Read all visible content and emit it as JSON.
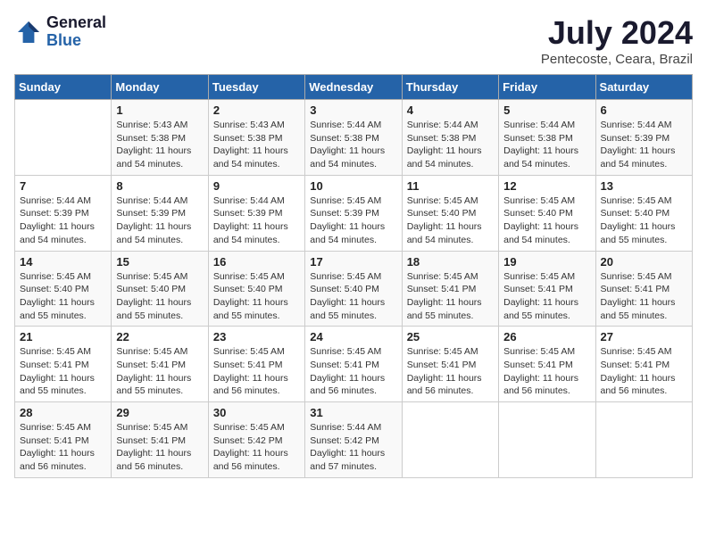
{
  "logo": {
    "text_general": "General",
    "text_blue": "Blue"
  },
  "title": "July 2024",
  "subtitle": "Pentecoste, Ceara, Brazil",
  "days_header": [
    "Sunday",
    "Monday",
    "Tuesday",
    "Wednesday",
    "Thursday",
    "Friday",
    "Saturday"
  ],
  "weeks": [
    [
      {
        "num": "",
        "info": ""
      },
      {
        "num": "1",
        "info": "Sunrise: 5:43 AM\nSunset: 5:38 PM\nDaylight: 11 hours\nand 54 minutes."
      },
      {
        "num": "2",
        "info": "Sunrise: 5:43 AM\nSunset: 5:38 PM\nDaylight: 11 hours\nand 54 minutes."
      },
      {
        "num": "3",
        "info": "Sunrise: 5:44 AM\nSunset: 5:38 PM\nDaylight: 11 hours\nand 54 minutes."
      },
      {
        "num": "4",
        "info": "Sunrise: 5:44 AM\nSunset: 5:38 PM\nDaylight: 11 hours\nand 54 minutes."
      },
      {
        "num": "5",
        "info": "Sunrise: 5:44 AM\nSunset: 5:38 PM\nDaylight: 11 hours\nand 54 minutes."
      },
      {
        "num": "6",
        "info": "Sunrise: 5:44 AM\nSunset: 5:39 PM\nDaylight: 11 hours\nand 54 minutes."
      }
    ],
    [
      {
        "num": "7",
        "info": "Sunrise: 5:44 AM\nSunset: 5:39 PM\nDaylight: 11 hours\nand 54 minutes."
      },
      {
        "num": "8",
        "info": "Sunrise: 5:44 AM\nSunset: 5:39 PM\nDaylight: 11 hours\nand 54 minutes."
      },
      {
        "num": "9",
        "info": "Sunrise: 5:44 AM\nSunset: 5:39 PM\nDaylight: 11 hours\nand 54 minutes."
      },
      {
        "num": "10",
        "info": "Sunrise: 5:45 AM\nSunset: 5:39 PM\nDaylight: 11 hours\nand 54 minutes."
      },
      {
        "num": "11",
        "info": "Sunrise: 5:45 AM\nSunset: 5:40 PM\nDaylight: 11 hours\nand 54 minutes."
      },
      {
        "num": "12",
        "info": "Sunrise: 5:45 AM\nSunset: 5:40 PM\nDaylight: 11 hours\nand 54 minutes."
      },
      {
        "num": "13",
        "info": "Sunrise: 5:45 AM\nSunset: 5:40 PM\nDaylight: 11 hours\nand 55 minutes."
      }
    ],
    [
      {
        "num": "14",
        "info": "Sunrise: 5:45 AM\nSunset: 5:40 PM\nDaylight: 11 hours\nand 55 minutes."
      },
      {
        "num": "15",
        "info": "Sunrise: 5:45 AM\nSunset: 5:40 PM\nDaylight: 11 hours\nand 55 minutes."
      },
      {
        "num": "16",
        "info": "Sunrise: 5:45 AM\nSunset: 5:40 PM\nDaylight: 11 hours\nand 55 minutes."
      },
      {
        "num": "17",
        "info": "Sunrise: 5:45 AM\nSunset: 5:40 PM\nDaylight: 11 hours\nand 55 minutes."
      },
      {
        "num": "18",
        "info": "Sunrise: 5:45 AM\nSunset: 5:41 PM\nDaylight: 11 hours\nand 55 minutes."
      },
      {
        "num": "19",
        "info": "Sunrise: 5:45 AM\nSunset: 5:41 PM\nDaylight: 11 hours\nand 55 minutes."
      },
      {
        "num": "20",
        "info": "Sunrise: 5:45 AM\nSunset: 5:41 PM\nDaylight: 11 hours\nand 55 minutes."
      }
    ],
    [
      {
        "num": "21",
        "info": "Sunrise: 5:45 AM\nSunset: 5:41 PM\nDaylight: 11 hours\nand 55 minutes."
      },
      {
        "num": "22",
        "info": "Sunrise: 5:45 AM\nSunset: 5:41 PM\nDaylight: 11 hours\nand 55 minutes."
      },
      {
        "num": "23",
        "info": "Sunrise: 5:45 AM\nSunset: 5:41 PM\nDaylight: 11 hours\nand 56 minutes."
      },
      {
        "num": "24",
        "info": "Sunrise: 5:45 AM\nSunset: 5:41 PM\nDaylight: 11 hours\nand 56 minutes."
      },
      {
        "num": "25",
        "info": "Sunrise: 5:45 AM\nSunset: 5:41 PM\nDaylight: 11 hours\nand 56 minutes."
      },
      {
        "num": "26",
        "info": "Sunrise: 5:45 AM\nSunset: 5:41 PM\nDaylight: 11 hours\nand 56 minutes."
      },
      {
        "num": "27",
        "info": "Sunrise: 5:45 AM\nSunset: 5:41 PM\nDaylight: 11 hours\nand 56 minutes."
      }
    ],
    [
      {
        "num": "28",
        "info": "Sunrise: 5:45 AM\nSunset: 5:41 PM\nDaylight: 11 hours\nand 56 minutes."
      },
      {
        "num": "29",
        "info": "Sunrise: 5:45 AM\nSunset: 5:41 PM\nDaylight: 11 hours\nand 56 minutes."
      },
      {
        "num": "30",
        "info": "Sunrise: 5:45 AM\nSunset: 5:42 PM\nDaylight: 11 hours\nand 56 minutes."
      },
      {
        "num": "31",
        "info": "Sunrise: 5:44 AM\nSunset: 5:42 PM\nDaylight: 11 hours\nand 57 minutes."
      },
      {
        "num": "",
        "info": ""
      },
      {
        "num": "",
        "info": ""
      },
      {
        "num": "",
        "info": ""
      }
    ]
  ]
}
